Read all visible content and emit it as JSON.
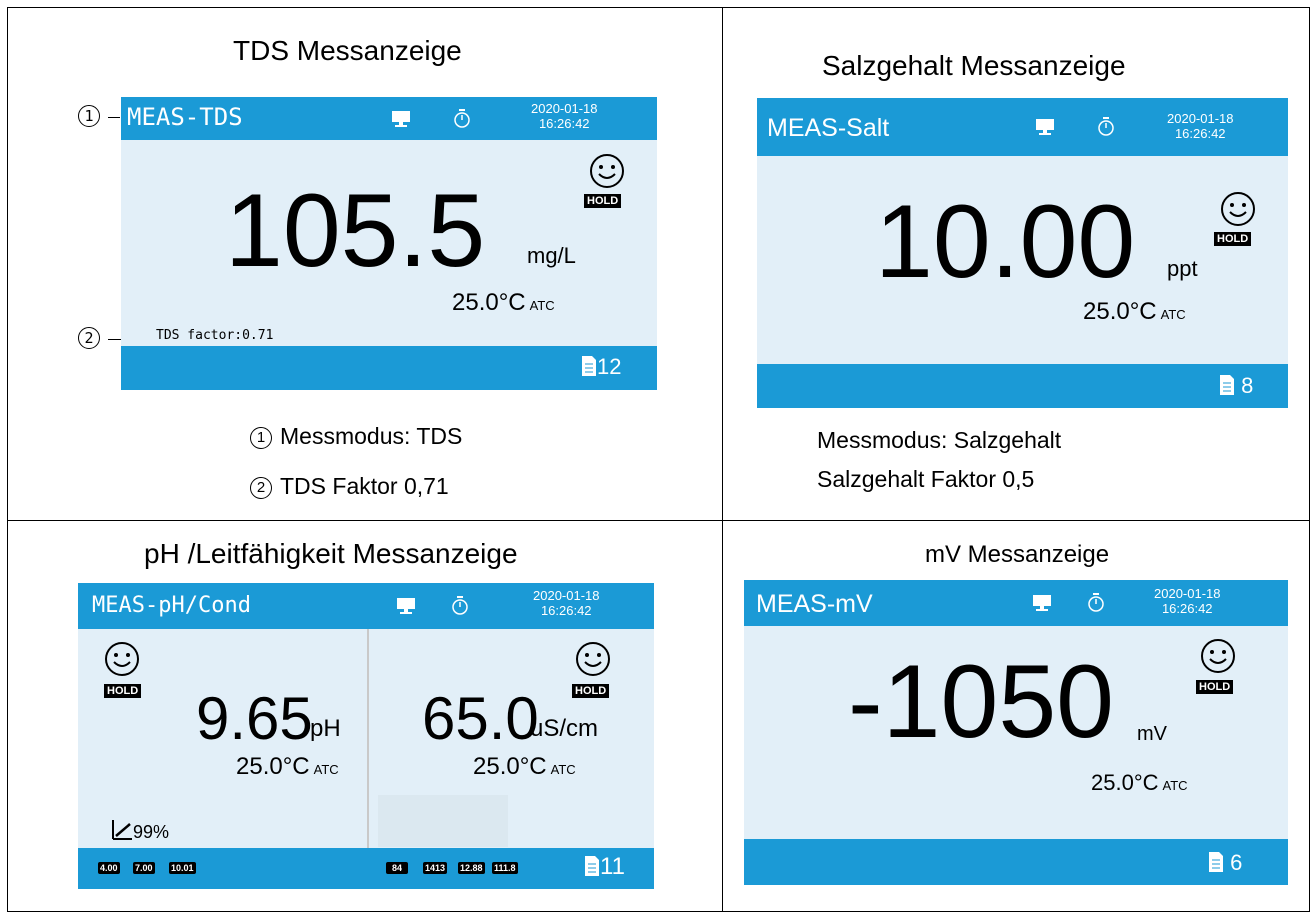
{
  "panels": {
    "tds": {
      "caption": "TDS Messanzeige",
      "mode": "MEAS-TDS",
      "date": "2020-01-18",
      "time": "16:26:42",
      "value": "105.5",
      "unit": "mg/L",
      "temp": "25.0°C",
      "atc": "ATC",
      "hold": "HOLD",
      "factor_label": "TDS factor:0.71",
      "records": "12",
      "callout1": "1",
      "callout2": "2",
      "note1": "Messmodus: TDS",
      "note2": "TDS Faktor 0,71"
    },
    "salt": {
      "caption": "Salzgehalt Messanzeige",
      "mode": "MEAS-Salt",
      "date": "2020-01-18",
      "time": "16:26:42",
      "value": "10.00",
      "unit": "ppt",
      "temp": "25.0°C",
      "atc": "ATC",
      "hold": "HOLD",
      "records": "8",
      "note1": "Messmodus: Salzgehalt",
      "note2": "Salzgehalt Faktor 0,5"
    },
    "phcond": {
      "caption": "pH /Leitfähigkeit Messanzeige",
      "mode": "MEAS-pH/Cond",
      "date": "2020-01-18",
      "time": "16:26:42",
      "ph_value": "9.65",
      "ph_unit": "pH",
      "cond_value": "65.0",
      "cond_unit": "uS/cm",
      "temp": "25.0°C",
      "atc": "ATC",
      "hold": "HOLD",
      "slope": "99%",
      "ph_buffers": [
        "4.00",
        "7.00",
        "10.01"
      ],
      "cond_buffers": [
        "84",
        "1413",
        "12.88",
        "111.8"
      ],
      "records": "11"
    },
    "mv": {
      "caption": "mV Messanzeige",
      "mode": "MEAS-mV",
      "date": "2020-01-18",
      "time": "16:26:42",
      "value": "-1050",
      "unit": "mV",
      "temp": "25.0°C",
      "atc": "ATC",
      "hold": "HOLD",
      "records": "6"
    }
  },
  "colors": {
    "bar": "#1b9ad6",
    "screen": "#e2eff8"
  },
  "icons": [
    "monitor-icon",
    "stopwatch-icon",
    "smiley-icon",
    "record-file-icon",
    "slope-icon",
    "buffer-cup-icon"
  ]
}
